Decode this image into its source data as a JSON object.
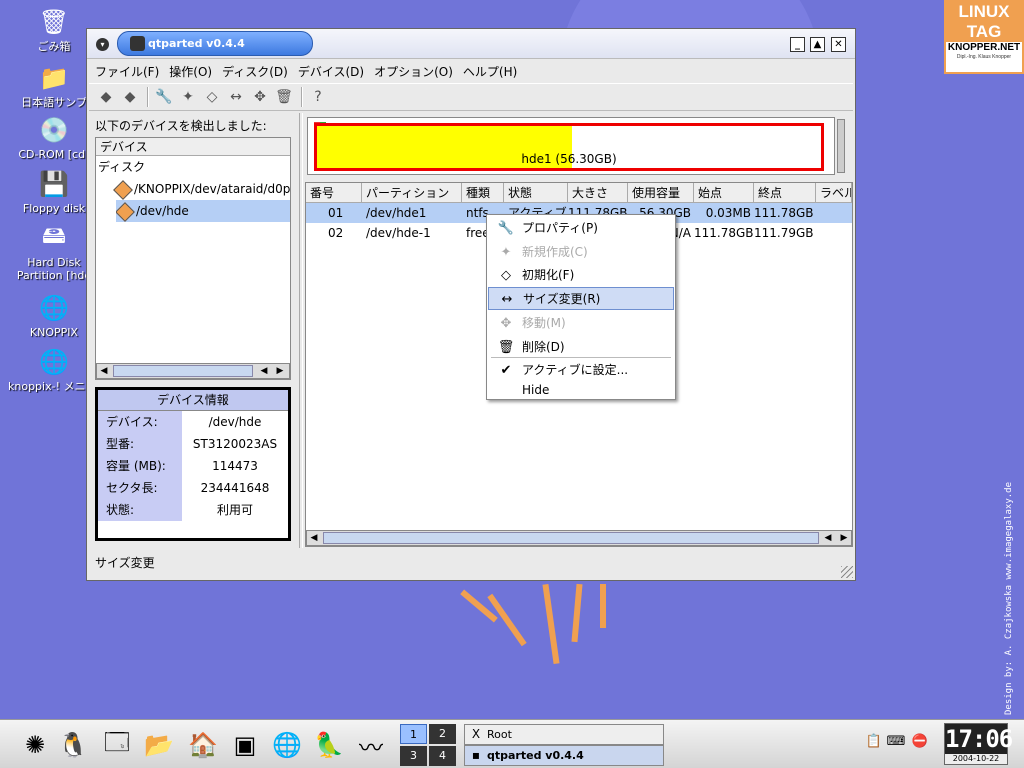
{
  "desktop": {
    "icons": [
      {
        "label": "ごみ箱",
        "icon": "trash-icon",
        "glyph": "🗑"
      },
      {
        "label": "日本語サンプ",
        "icon": "folder-icon",
        "glyph": "📁"
      },
      {
        "label": "CD-ROM [cdr",
        "icon": "cdrom-icon",
        "glyph": "💿"
      },
      {
        "label": "Floppy disk",
        "icon": "floppy-icon",
        "glyph": "💾"
      },
      {
        "label": "Hard Disk Partition [hde",
        "icon": "harddisk-icon",
        "glyph": "🖴"
      },
      {
        "label": "KNOPPIX",
        "icon": "knoppix-icon",
        "glyph": "🌐"
      },
      {
        "label": "knoppix-! メニュー",
        "icon": "knoppix-menu-icon",
        "glyph": "🌐"
      }
    ],
    "logo": {
      "line1": "LINUX",
      "line2": "TAG",
      "line3": "KNOPPER.NET",
      "line4": "Dipl.-Ing. Klaus Knopper"
    },
    "credit": "Design by: A. Czajkowska  www.imagegalaxy.de"
  },
  "window": {
    "title": "qtparted v0.4.4",
    "menu": [
      "ファイル(F)",
      "操作(O)",
      "ディスク(D)",
      "デバイス(D)",
      "オプション(O)",
      "ヘルプ(H)"
    ],
    "toolbar_glyphs": [
      "◆",
      "◆",
      "🔧",
      "✦",
      "◇",
      "↔",
      "✥",
      "🗑",
      "?"
    ],
    "left_caption": "以下のデバイスを検出しました:",
    "tree": {
      "header": "デバイス",
      "group": "ディスク",
      "items": [
        "/KNOPPIX/dev/ataraid/d0p",
        "/dev/hde"
      ]
    },
    "device_info": {
      "title": "デバイス情報",
      "rows": [
        {
          "k": "デバイス:",
          "v": "/dev/hde"
        },
        {
          "k": "型番:",
          "v": "ST3120023AS"
        },
        {
          "k": "容量 (MB):",
          "v": "114473"
        },
        {
          "k": "セクタ長:",
          "v": "234441648"
        },
        {
          "k": "状態:",
          "v": "利用可"
        }
      ]
    },
    "disk_map": {
      "label": "hde1 (56.30GB)",
      "used_fraction": 0.505
    },
    "table": {
      "headers": [
        "番号",
        "パーティション",
        "種類",
        "状態",
        "大きさ",
        "使用容量",
        "始点",
        "終点",
        "ラベル"
      ],
      "rows": [
        [
          "01",
          "/dev/hde1",
          "ntfs",
          "アクティブ",
          "111.78GB",
          "56.30GB",
          "0.03MB",
          "111.78GB",
          ""
        ],
        [
          "02",
          "/dev/hde-1",
          "free",
          "",
          "",
          "N/A",
          "111.78GB",
          "111.79GB",
          ""
        ]
      ]
    },
    "status": "サイズ変更"
  },
  "context_menu": {
    "items": [
      {
        "label": "プロパティ(P)",
        "glyph": "🔧",
        "disabled": false
      },
      {
        "label": "新規作成(C)",
        "glyph": "✦",
        "disabled": true
      },
      {
        "label": "初期化(F)",
        "glyph": "◇",
        "disabled": false
      },
      {
        "label": "サイズ変更(R)",
        "glyph": "↔",
        "disabled": false
      },
      {
        "label": "移動(M)",
        "glyph": "✥",
        "disabled": true
      },
      {
        "label": "削除(D)",
        "glyph": "🗑",
        "disabled": false
      },
      {
        "label": "アクティブに設定...",
        "glyph": "✔",
        "disabled": false
      },
      {
        "label": "Hide",
        "glyph": "",
        "disabled": false
      }
    ]
  },
  "taskbar": {
    "pager": [
      "1",
      "2",
      "3",
      "4"
    ],
    "tasks": [
      "Root",
      "qtparted v0.4.4"
    ],
    "clock_time": "17:06",
    "clock_date": "2004-10-22"
  },
  "colors": {
    "desktop": "#7074d8",
    "selection": "#b5cff5",
    "disk_used": "#ffff00",
    "disk_border": "#ee0000"
  }
}
